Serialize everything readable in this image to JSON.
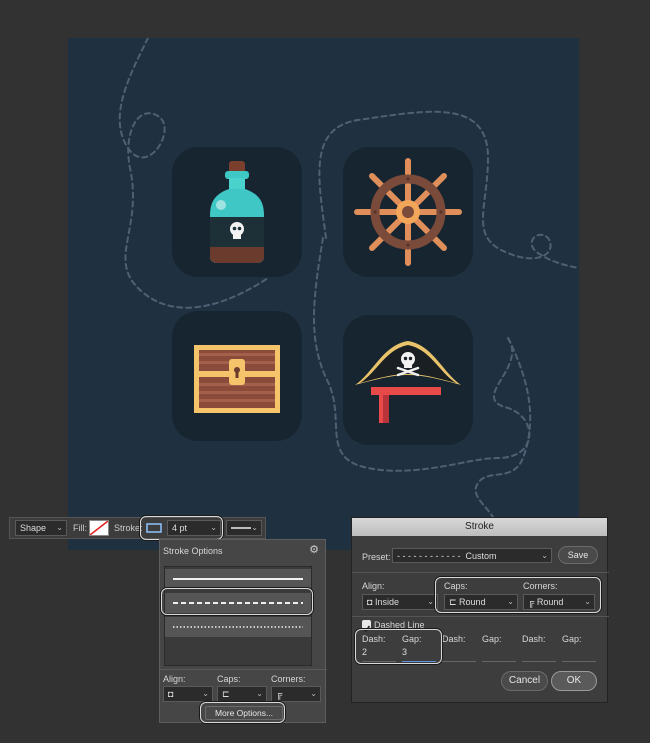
{
  "options_bar": {
    "mode_label": "Shape",
    "fill_label": "Fill:",
    "stroke_label": "Stroke:",
    "stroke_width": "4 pt"
  },
  "stroke_options_panel": {
    "title": "Stroke Options",
    "align_label": "Align:",
    "caps_label": "Caps:",
    "corners_label": "Corners:",
    "more_options_button": "More Options..."
  },
  "stroke_dialog": {
    "title": "Stroke",
    "preset_label": "Preset:",
    "preset_value": "Custom",
    "save_button": "Save",
    "align_label": "Align:",
    "align_value": "Inside",
    "caps_label": "Caps:",
    "caps_value": "Round",
    "corners_label": "Corners:",
    "corners_value": "Round",
    "dashed_line_label": "Dashed Line",
    "dashed_line_checked": true,
    "dash_gap_fields": [
      {
        "label": "Dash:",
        "value": "2"
      },
      {
        "label": "Gap:",
        "value": "3"
      },
      {
        "label": "Dash:",
        "value": ""
      },
      {
        "label": "Gap:",
        "value": ""
      },
      {
        "label": "Dash:",
        "value": ""
      },
      {
        "label": "Gap:",
        "value": ""
      }
    ],
    "cancel_button": "Cancel",
    "ok_button": "OK"
  },
  "icons": [
    "rum-bottle-icon",
    "ship-wheel-icon",
    "treasure-chest-icon",
    "pirate-hat-icon"
  ],
  "colors": {
    "canvas_bg": "#1f3041",
    "tile_bg": "#172530",
    "app_bg": "#323232",
    "highlight": "#d9d9d9"
  }
}
